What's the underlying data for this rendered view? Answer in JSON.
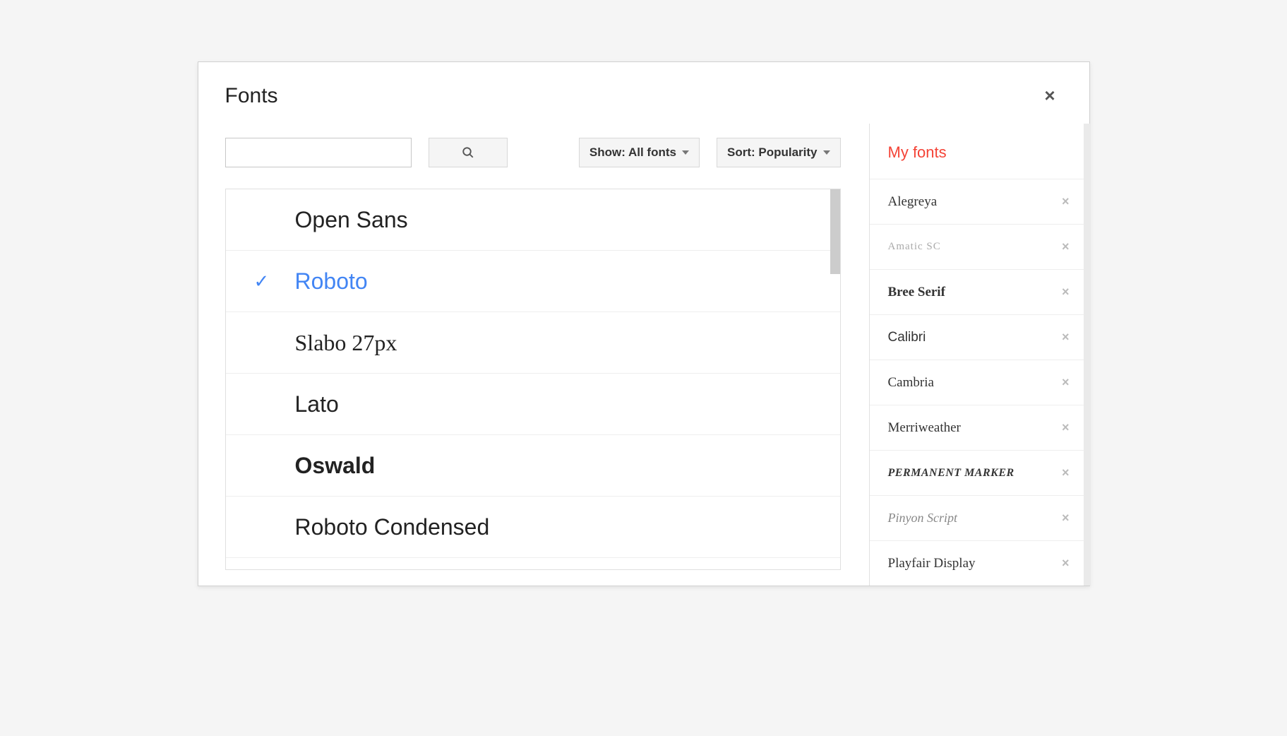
{
  "dialog": {
    "title": "Fonts"
  },
  "controls": {
    "search_value": "",
    "show_label": "Show: All fonts",
    "sort_label": "Sort: Popularity"
  },
  "font_list": [
    {
      "name": "Open Sans",
      "selected": false,
      "class": "f-opensans"
    },
    {
      "name": "Roboto",
      "selected": true,
      "class": "f-roboto"
    },
    {
      "name": "Slabo 27px",
      "selected": false,
      "class": "f-slabo"
    },
    {
      "name": "Lato",
      "selected": false,
      "class": "f-lato"
    },
    {
      "name": "Oswald",
      "selected": false,
      "class": "f-oswald"
    },
    {
      "name": "Roboto Condensed",
      "selected": false,
      "class": "f-robotocond"
    }
  ],
  "my_fonts": {
    "header": "My fonts",
    "items": [
      {
        "name": "Alegreya",
        "class": "mf-alegreya"
      },
      {
        "name": "Amatic SC",
        "class": "mf-amatic"
      },
      {
        "name": "Bree Serif",
        "class": "mf-bree"
      },
      {
        "name": "Calibri",
        "class": "mf-calibri"
      },
      {
        "name": "Cambria",
        "class": "mf-cambria"
      },
      {
        "name": "Merriweather",
        "class": "mf-merri"
      },
      {
        "name": "Permanent Marker",
        "class": "mf-permanent"
      },
      {
        "name": "Pinyon Script",
        "class": "mf-pinyon"
      },
      {
        "name": "Playfair Display",
        "class": "mf-playfair"
      }
    ]
  }
}
